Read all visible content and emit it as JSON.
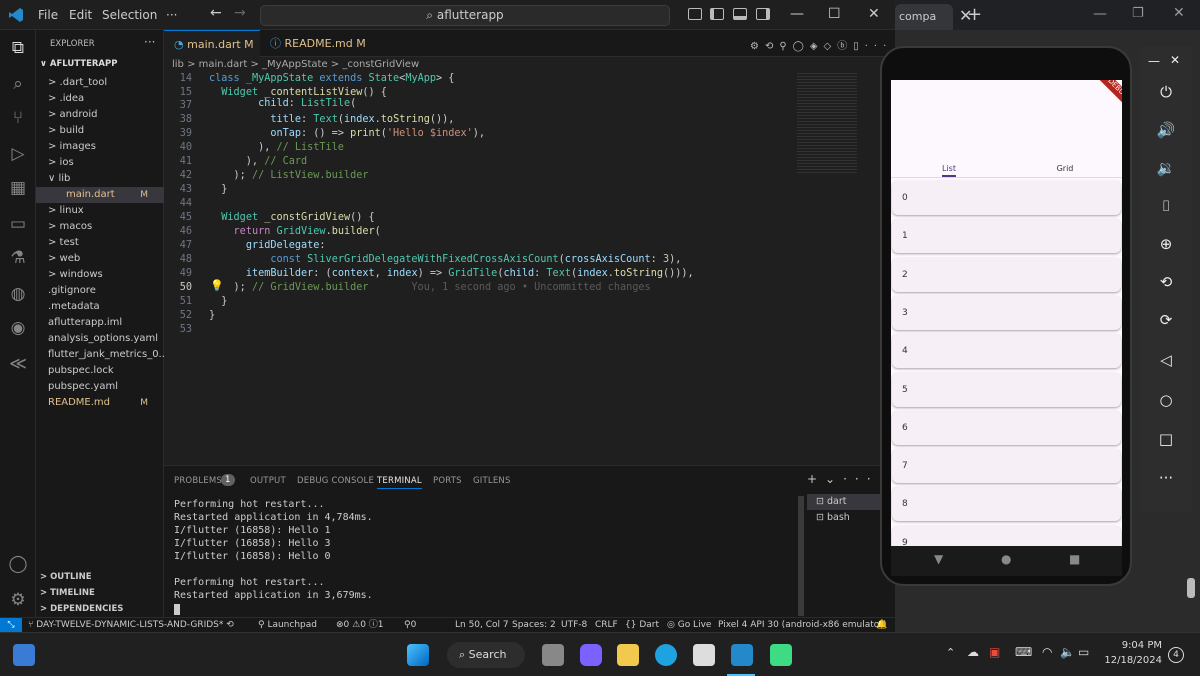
{
  "vscode": {
    "menu": [
      "File",
      "Edit",
      "Selection",
      "···"
    ],
    "search_text": "aflutterapp",
    "explorer_title": "EXPLORER",
    "project": "AFLUTTERAPP",
    "tree": [
      {
        "label": "> .dart_tool",
        "indent": 0
      },
      {
        "label": "> .idea",
        "indent": 0
      },
      {
        "label": "> android",
        "indent": 0
      },
      {
        "label": "> build",
        "indent": 0
      },
      {
        "label": "> images",
        "indent": 0
      },
      {
        "label": "> ios",
        "indent": 0
      },
      {
        "label": "∨ lib",
        "indent": 0
      },
      {
        "label": "main.dart",
        "indent": 1,
        "badge": "M"
      },
      {
        "label": "> linux",
        "indent": 0
      },
      {
        "label": "> macos",
        "indent": 0
      },
      {
        "label": "> test",
        "indent": 0
      },
      {
        "label": "> web",
        "indent": 0
      },
      {
        "label": "> windows",
        "indent": 0
      },
      {
        "label": ".gitignore",
        "indent": 0
      },
      {
        "label": ".metadata",
        "indent": 0
      },
      {
        "label": "aflutterapp.iml",
        "indent": 0
      },
      {
        "label": "analysis_options.yaml",
        "indent": 0
      },
      {
        "label": "flutter_jank_metrics_0...",
        "indent": 0
      },
      {
        "label": "pubspec.lock",
        "indent": 0
      },
      {
        "label": "pubspec.yaml",
        "indent": 0
      },
      {
        "label": "README.md",
        "indent": 0,
        "badge": "M"
      }
    ],
    "outline": "> OUTLINE",
    "timeline": "> TIMELINE",
    "dependencies": "> DEPENDENCIES",
    "tab1": "main.dart M",
    "tab2": "README.md M",
    "breadcrumb": "lib > main.dart > _MyAppState > _constGridView",
    "panel_tabs": [
      "PROBLEMS",
      "1",
      "OUTPUT",
      "DEBUG CONSOLE",
      "TERMINAL",
      "PORTS",
      "GITLENS"
    ],
    "terminal": [
      "Performing hot restart...",
      "Restarted application in 4,784ms.",
      "I/flutter (16858): Hello 1",
      "I/flutter (16858): Hello 3",
      "I/flutter (16858): Hello 0",
      "",
      "Performing hot restart...",
      "Restarted application in 3,679ms."
    ],
    "term_list": [
      "dart",
      "bash"
    ],
    "status": {
      "branch": "DAY-TWELVE-DYNAMIC-LISTS-AND-GRIDS*",
      "launch": "Launchpad",
      "problems": "⊗0 ⚠0 ⓘ1",
      "ports": "⚲0",
      "pos": "Ln 50, Col 7",
      "spaces": "Spaces: 2",
      "enc": "UTF-8",
      "eol": "CRLF",
      "lang": "Dart",
      "live": "Go Live",
      "device": "Pixel 4 API 30 (android-x86 emulator)"
    }
  },
  "emulator": {
    "tabs": [
      "List",
      "Grid"
    ],
    "items": [
      "0",
      "1",
      "2",
      "3",
      "4",
      "5",
      "6",
      "7",
      "8",
      "9"
    ],
    "debug": "DEBUG"
  },
  "chrome": {
    "tab": "compa"
  },
  "taskbar": {
    "search": "Search",
    "time": "9:04 PM",
    "date": "12/18/2024",
    "notif": "4"
  }
}
